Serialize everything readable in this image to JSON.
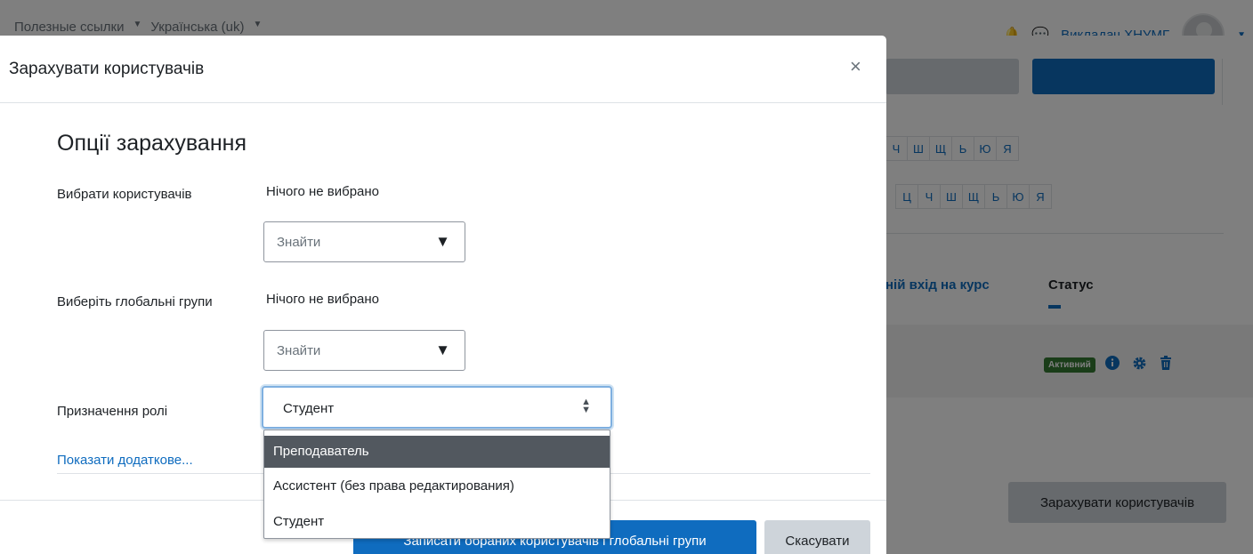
{
  "top_nav": {
    "useful_links": "Полезные ссылки",
    "language": "Українська (uk)",
    "user_name": "Викладач ХНУМГ"
  },
  "background": {
    "alphabet_row_1": [
      "Ч",
      "Ш",
      "Щ",
      "Ь",
      "Ю",
      "Я"
    ],
    "alphabet_row_2": [
      "Ц",
      "Ч",
      "Ш",
      "Щ",
      "Ь",
      "Ю",
      "Я"
    ],
    "col_last_access": "ній вхід на курс",
    "col_status": "Статус",
    "status_badge": "Активний",
    "enrol_button": "Зарахувати користувачів"
  },
  "modal": {
    "title": "Зарахувати користувачів",
    "close_glyph": "×",
    "section_title": "Опції зарахування",
    "select_users": {
      "label": "Вибрати користувачів",
      "selection": "Нічого не вибрано",
      "placeholder": "Знайти"
    },
    "select_cohorts": {
      "label": "Виберіть глобальні групи",
      "selection": "Нічого не вибрано",
      "placeholder": "Знайти"
    },
    "role": {
      "label": "Призначення ролі",
      "value": "Студент",
      "options": [
        "Преподаватель",
        "Ассистент (без права редактирования)",
        "Студент"
      ],
      "highlighted_index": 0
    },
    "show_more": "Показати додаткове...",
    "submit_button": "Записати обраних користувачів і глобальні групи",
    "cancel_button": "Скасувати"
  },
  "colors": {
    "primary": "#0f6cbf",
    "badge_success": "#357a32",
    "option_highlight": "#52585f"
  }
}
